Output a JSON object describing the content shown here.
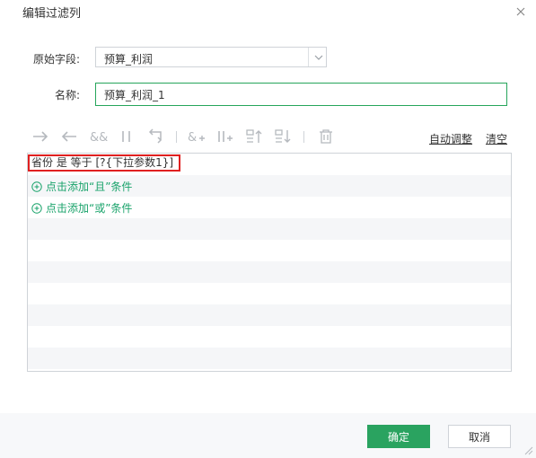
{
  "dialog": {
    "title": "编辑过滤列",
    "close_icon": "close-icon"
  },
  "form": {
    "original_field_label": "原始字段:",
    "original_field_value": "预算_利润",
    "name_label": "名称:",
    "name_value": "预算_利润_1"
  },
  "toolbar": {
    "icons": [
      "arrow-right-icon",
      "arrow-left-icon",
      "and-icon",
      "or-icon",
      "wrap-icon",
      "and-add-icon",
      "or-add-icon",
      "move-up-icon",
      "move-down-icon",
      "delete-icon"
    ],
    "auto_adjust_label": "自动调整",
    "clear_label": "清空"
  },
  "filter": {
    "condition_text": "省份 是 等于 [?{下拉参数1}]",
    "add_and_label": "点击添加“且”条件",
    "add_or_label": "点击添加“或”条件"
  },
  "footer": {
    "ok_label": "确定",
    "cancel_label": "取消"
  },
  "colors": {
    "accent": "#2aa360",
    "link_green": "#1aa36b",
    "highlight_red": "#e02020",
    "icon_gray": "#b5b9be",
    "border": "#cfd3d8"
  }
}
